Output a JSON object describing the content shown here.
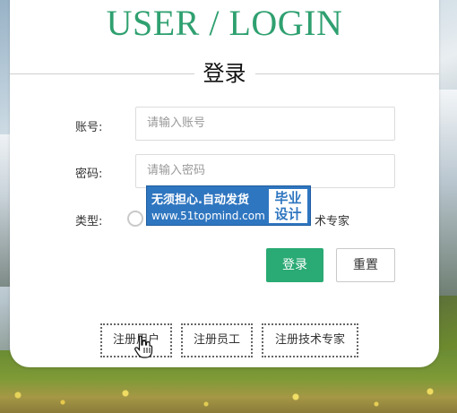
{
  "header": {
    "title": "USER / LOGIN",
    "subtitle": "登录"
  },
  "form": {
    "account_label": "账号:",
    "account_placeholder": "请输入账号",
    "password_label": "密码:",
    "password_placeholder": "请输入密码",
    "type_label": "类型:",
    "type_options_visible_text": "术专家"
  },
  "actions": {
    "login_label": "登录",
    "reset_label": "重置"
  },
  "register": {
    "user_label": "注册用户",
    "employee_label": "注册员工",
    "expert_label": "注册技术专家"
  },
  "watermark": {
    "line1": "无须担心.自动发货",
    "line2": "www.51topmind.com",
    "box_line1": "毕业",
    "box_line2": "设计"
  },
  "colors": {
    "brand_green": "#2aaa74",
    "title_green": "#2fa070",
    "watermark_blue": "#2f76c0"
  }
}
